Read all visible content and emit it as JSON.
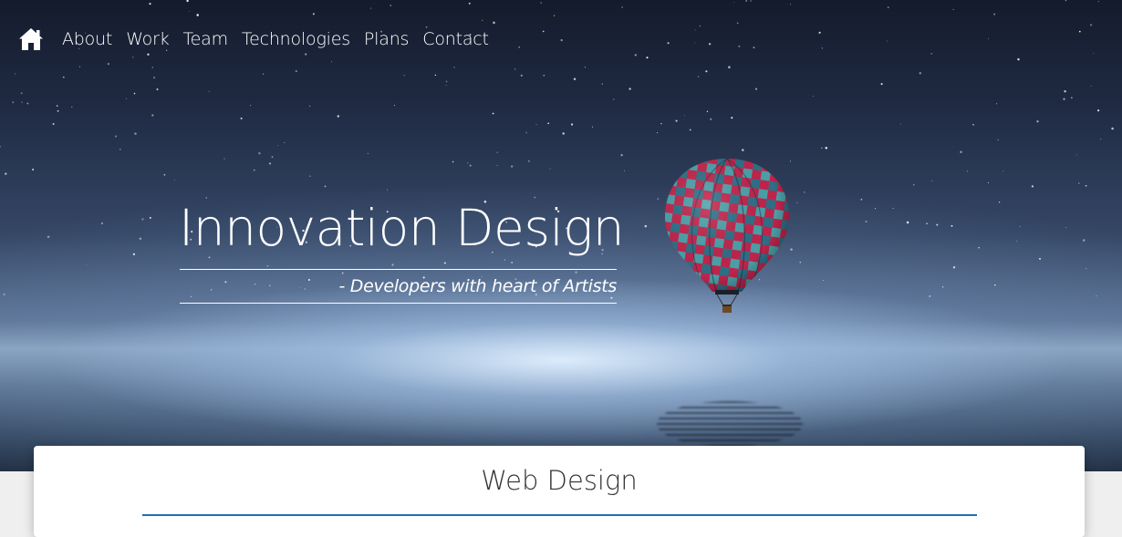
{
  "nav": {
    "home_icon": "home-icon",
    "items": [
      {
        "label": "About"
      },
      {
        "label": "Work"
      },
      {
        "label": "Team"
      },
      {
        "label": "Technologies"
      },
      {
        "label": "Plans"
      },
      {
        "label": "Contact"
      }
    ]
  },
  "hero": {
    "title": "Innovation Design",
    "tagline": "- Developers with heart of Artists",
    "illustration": "hot-air-balloon"
  },
  "card": {
    "title": "Web Design"
  },
  "colors": {
    "text_light": "#ffffff",
    "card_title": "#333333",
    "accent": "#1f6fb2",
    "page_bg": "#efefef"
  }
}
